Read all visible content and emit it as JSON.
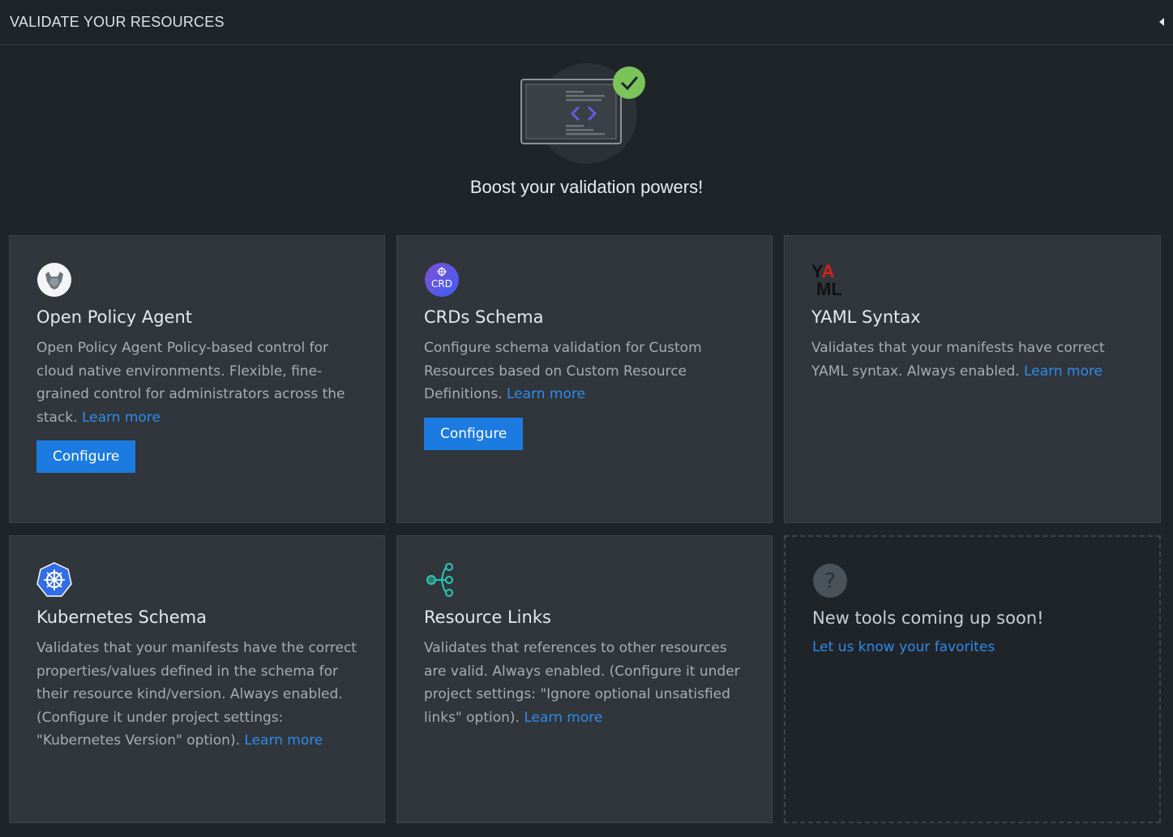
{
  "header": {
    "title": "VALIDATE YOUR RESOURCES",
    "collapse_icon": "caret-left-icon"
  },
  "hero": {
    "title": "Boost your validation powers!",
    "illustration_icon": "code-window-check-icon"
  },
  "colors": {
    "background": "#1f2429",
    "card": "#30363c",
    "accent": "#1b7be0",
    "link": "#2f8bea",
    "check": "#7cc35a",
    "code_brackets": "#6f57d9"
  },
  "cards": [
    {
      "icon": "opa-icon",
      "title": "Open Policy Agent",
      "description": "Open Policy Agent Policy-based control for cloud native environments. Flexible, fine-grained control for administrators across the stack.",
      "link": "Learn more",
      "button": "Configure"
    },
    {
      "icon": "crd-icon",
      "icon_text": "CRD",
      "title": "CRDs Schema",
      "description": "Configure schema validation for Custom Resources based on Custom Resource Definitions.",
      "link": "Learn more",
      "button": "Configure"
    },
    {
      "icon": "yaml-icon",
      "icon_text_top": "YA",
      "icon_text_bottom": "ML",
      "title": "YAML Syntax",
      "description": "Validates that your manifests have correct YAML syntax. Always enabled.",
      "link": "Learn more"
    },
    {
      "icon": "kubernetes-icon",
      "title": "Kubernetes Schema",
      "description": "Validates that your manifests have the correct properties/values defined in the schema for their resource kind/version. Always enabled. (Configure it under project settings: \"Kubernetes Version\" option).",
      "link": "Learn more"
    },
    {
      "icon": "resource-links-icon",
      "title": "Resource Links",
      "description": "Validates that references to other resources are valid. Always enabled. (Configure it under project settings: \"Ignore optional unsatisfied links\" option).",
      "link": "Learn more"
    },
    {
      "icon": "question-icon",
      "icon_text": "?",
      "title": "New tools coming up soon!",
      "link": "Let us know your favorites"
    }
  ]
}
